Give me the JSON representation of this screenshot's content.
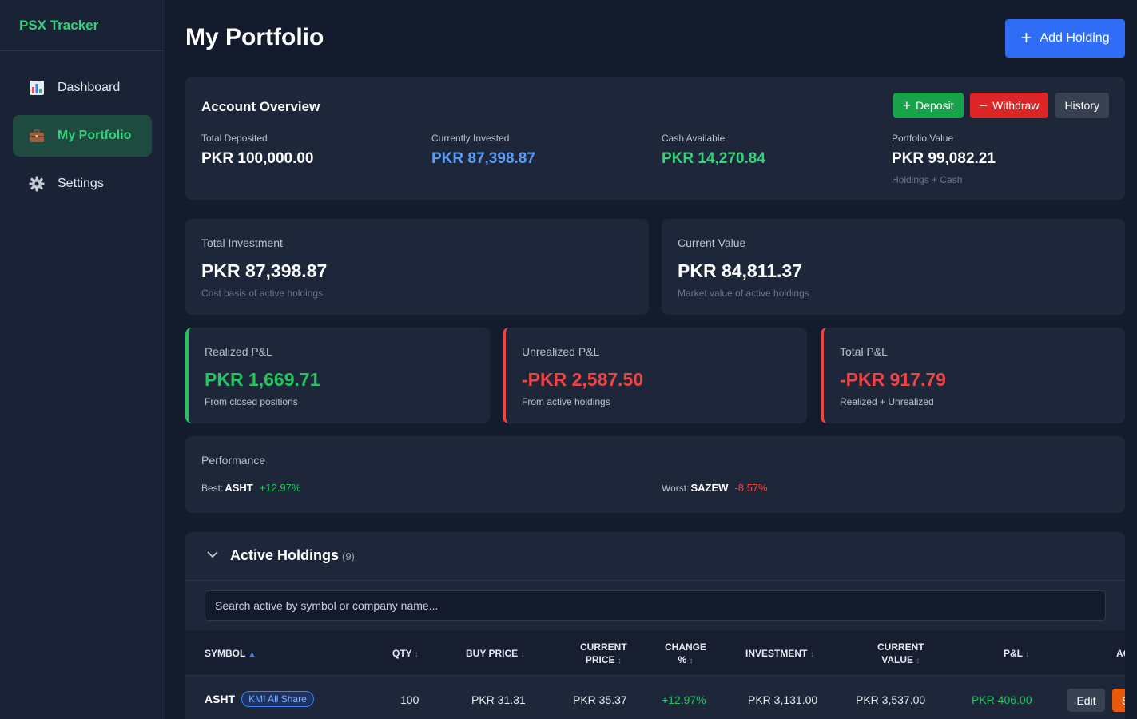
{
  "app": {
    "title": "PSX Tracker"
  },
  "sidebar": {
    "items": [
      {
        "label": "Dashboard",
        "icon": "bar-chart-icon"
      },
      {
        "label": "My Portfolio",
        "icon": "briefcase-icon",
        "active": true
      },
      {
        "label": "Settings",
        "icon": "gear-icon"
      }
    ]
  },
  "header": {
    "title": "My Portfolio",
    "add_label": "Add Holding"
  },
  "overview": {
    "title": "Account Overview",
    "actions": {
      "deposit": "Deposit",
      "withdraw": "Withdraw",
      "history": "History"
    },
    "stats": [
      {
        "label": "Total Deposited",
        "value": "PKR 100,000.00"
      },
      {
        "label": "Currently Invested",
        "value": "PKR 87,398.87"
      },
      {
        "label": "Cash Available",
        "value": "PKR 14,270.84"
      },
      {
        "label": "Portfolio Value",
        "value": "PKR 99,082.21",
        "sub": "Holdings + Cash"
      }
    ]
  },
  "summary": {
    "investment": {
      "label": "Total Investment",
      "value": "PKR 87,398.87",
      "sub": "Cost basis of active holdings"
    },
    "current": {
      "label": "Current Value",
      "value": "PKR 84,811.37",
      "sub": "Market value of active holdings"
    }
  },
  "pnl": {
    "realized": {
      "label": "Realized P&L",
      "value": "PKR 1,669.71",
      "sub": "From closed positions"
    },
    "unrealized": {
      "label": "Unrealized P&L",
      "value": "-PKR 2,587.50",
      "sub": "From active holdings"
    },
    "total": {
      "label": "Total P&L",
      "value": "-PKR 917.79",
      "sub": "Realized + Unrealized"
    }
  },
  "performance": {
    "label": "Performance",
    "best": {
      "tag": "Best:",
      "symbol": "ASHT",
      "change": "+12.97%"
    },
    "worst": {
      "tag": "Worst:",
      "symbol": "SAZEW",
      "change": "-8.57%"
    }
  },
  "holdings": {
    "title": "Active Holdings",
    "count": "(9)",
    "search_placeholder": "Search active by symbol or company name...",
    "columns": {
      "symbol": "SYMBOL",
      "qty": "QTY",
      "buy_price": "BUY PRICE",
      "current_price_1": "CURRENT",
      "current_price_2": "PRICE",
      "change_1": "CHANGE",
      "change_2": "%",
      "investment": "INVESTMENT",
      "current_value_1": "CURRENT",
      "current_value_2": "VALUE",
      "pnl": "P&L",
      "actions": "AC"
    },
    "rows": [
      {
        "symbol": "ASHT",
        "badge": "KMI All Share",
        "qty": "100",
        "buy_price": "PKR 31.31",
        "current_price": "PKR 35.37",
        "change": "+12.97%",
        "investment": "PKR 3,131.00",
        "current_value": "PKR 3,537.00",
        "pnl": "PKR 406.00",
        "edit": "Edit",
        "sell": "S"
      }
    ]
  },
  "colors": {
    "accent_green": "#34d27b",
    "positive": "#22c55e",
    "negative": "#ef4444",
    "blue": "#5b9cf6",
    "primary_button": "#2f6df6"
  }
}
